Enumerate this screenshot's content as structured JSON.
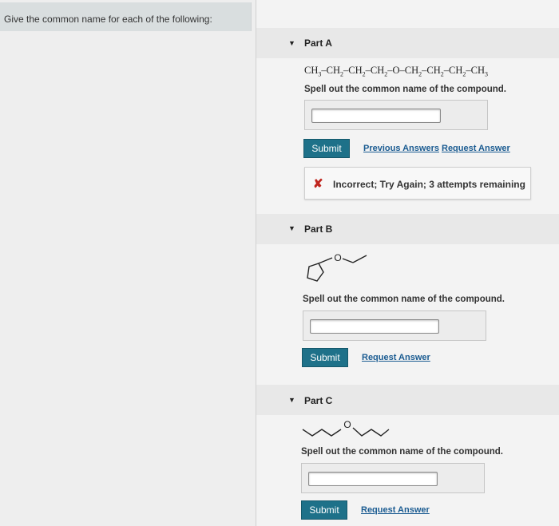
{
  "intro": {
    "text": "Give the common name for each of the following:"
  },
  "partA": {
    "title": "Part A",
    "formula": [
      {
        "t": "CH"
      },
      {
        "s": "3"
      },
      {
        "t": "–CH"
      },
      {
        "s": "2"
      },
      {
        "t": "–CH"
      },
      {
        "s": "2"
      },
      {
        "t": "–CH"
      },
      {
        "s": "2"
      },
      {
        "t": "–O–CH"
      },
      {
        "s": "2"
      },
      {
        "t": "–CH"
      },
      {
        "s": "2"
      },
      {
        "t": "–CH"
      },
      {
        "s": "2"
      },
      {
        "t": "–CH"
      },
      {
        "s": "3"
      }
    ],
    "instruction": "Spell out the common name of the compound.",
    "answer_value": "",
    "submit_label": "Submit",
    "previous_answers_label": "Previous Answers",
    "request_answer_label": "Request Answer",
    "feedback": "Incorrect; Try Again; 3 attempts remaining",
    "feedback_icon": "x-icon"
  },
  "partB": {
    "title": "Part B",
    "atom_label": "O",
    "instruction": "Spell out the common name of the compound.",
    "answer_value": "",
    "submit_label": "Submit",
    "request_answer_label": "Request Answer"
  },
  "partC": {
    "title": "Part C",
    "atom_label": "O",
    "instruction": "Spell out the common name of the compound.",
    "answer_value": "",
    "submit_label": "Submit",
    "request_answer_label": "Request Answer"
  },
  "colors": {
    "submit": "#1e7189",
    "link": "#1a5b91",
    "error": "#c0261f"
  }
}
